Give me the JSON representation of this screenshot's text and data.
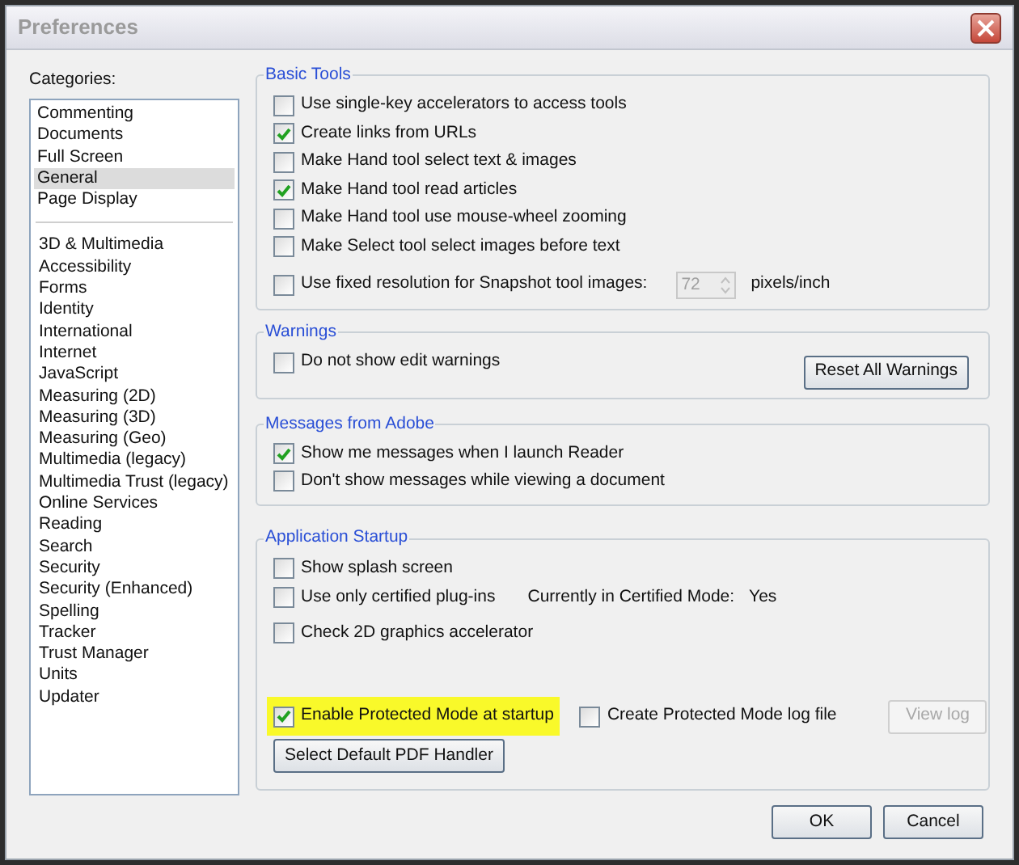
{
  "window": {
    "title": "Preferences"
  },
  "categories": {
    "label": "Categories:",
    "groups": [
      [
        {
          "label": "Commenting",
          "selected": false
        },
        {
          "label": "Documents",
          "selected": false
        },
        {
          "label": "Full Screen",
          "selected": false
        },
        {
          "label": "General",
          "selected": true
        },
        {
          "label": "Page Display",
          "selected": false
        }
      ],
      [
        {
          "label": "3D & Multimedia",
          "selected": false
        },
        {
          "label": "Accessibility",
          "selected": false
        },
        {
          "label": "Forms",
          "selected": false
        },
        {
          "label": "Identity",
          "selected": false
        },
        {
          "label": "International",
          "selected": false
        },
        {
          "label": "Internet",
          "selected": false
        },
        {
          "label": "JavaScript",
          "selected": false
        },
        {
          "label": "Measuring (2D)",
          "selected": false
        },
        {
          "label": "Measuring (3D)",
          "selected": false
        },
        {
          "label": "Measuring (Geo)",
          "selected": false
        },
        {
          "label": "Multimedia (legacy)",
          "selected": false
        },
        {
          "label": "Multimedia Trust (legacy)",
          "selected": false
        },
        {
          "label": "Online Services",
          "selected": false
        },
        {
          "label": "Reading",
          "selected": false
        },
        {
          "label": "Search",
          "selected": false
        },
        {
          "label": "Security",
          "selected": false
        },
        {
          "label": "Security (Enhanced)",
          "selected": false
        },
        {
          "label": "Spelling",
          "selected": false
        },
        {
          "label": "Tracker",
          "selected": false
        },
        {
          "label": "Trust Manager",
          "selected": false
        },
        {
          "label": "Units",
          "selected": false
        },
        {
          "label": "Updater",
          "selected": false
        }
      ]
    ]
  },
  "basic_tools": {
    "title": "Basic Tools",
    "options": [
      {
        "label": "Use single-key accelerators to access tools",
        "checked": false
      },
      {
        "label": "Create links from URLs",
        "checked": true
      },
      {
        "label": "Make Hand tool select text & images",
        "checked": false
      },
      {
        "label": "Make Hand tool read articles",
        "checked": true
      },
      {
        "label": "Make Hand tool use mouse-wheel zooming",
        "checked": false
      },
      {
        "label": "Make Select tool select images before text",
        "checked": false
      }
    ],
    "snapshot": {
      "label": "Use fixed resolution for Snapshot tool images:",
      "checked": false,
      "value": "72",
      "disabled": true,
      "unit": "pixels/inch"
    }
  },
  "warnings": {
    "title": "Warnings",
    "option": {
      "label": "Do not show edit warnings",
      "checked": false
    },
    "button": "Reset All Warnings"
  },
  "messages": {
    "title": "Messages from Adobe",
    "options": [
      {
        "label": "Show me messages when I launch Reader",
        "checked": true
      },
      {
        "label": "Don't show messages while viewing a document",
        "checked": false
      }
    ]
  },
  "startup": {
    "title": "Application Startup",
    "splash": {
      "label": "Show splash screen",
      "checked": false
    },
    "certified": {
      "label": "Use only certified plug-ins",
      "checked": false
    },
    "certified_status": {
      "label": "Currently in Certified Mode:",
      "value": "Yes"
    },
    "graphics": {
      "label": "Check 2D graphics accelerator",
      "checked": false
    },
    "protected": {
      "label": "Enable Protected Mode at startup",
      "checked": true,
      "highlighted": true
    },
    "log": {
      "label": "Create Protected Mode log file",
      "checked": false
    },
    "view_log": {
      "label": "View log",
      "disabled": true
    },
    "handler_button": "Select Default PDF Handler"
  },
  "buttons": [
    "OK",
    "Cancel"
  ]
}
